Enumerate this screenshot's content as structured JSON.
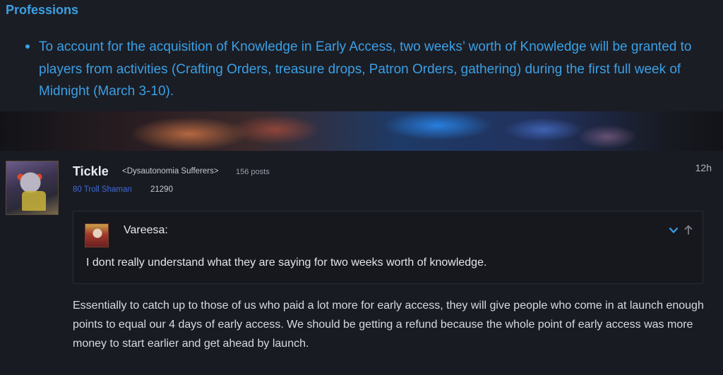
{
  "announcement": {
    "heading": "Professions",
    "bullets": [
      "To account for the acquisition of Knowledge in Early Access, two weeks’ worth of Knowledge will be granted to players from activities (Crafting Orders, treasure drops, Patron Orders, gathering) during the first full week of Midnight (March 3-10)."
    ]
  },
  "post": {
    "username": "Tickle",
    "guild": "<Dysautonomia Sufferers>",
    "post_count": "156 posts",
    "character": "80 Troll Shaman",
    "achievement_points": "21290",
    "timestamp": "12h",
    "quote": {
      "author": "Vareesa:",
      "text": "I dont really understand what they are saying for two weeks worth of knowledge."
    },
    "body": "Essentially to catch up to those of us who paid a lot more for early access, they will give people who come in at launch enough points to equal our 4 days of early access. We should be getting a refund because the whole point of early access was more money to start earlier and get ahead by launch."
  },
  "colors": {
    "accent": "#3aa0e6",
    "class_shaman": "#3f6ad6",
    "background": "#1a1c23"
  }
}
